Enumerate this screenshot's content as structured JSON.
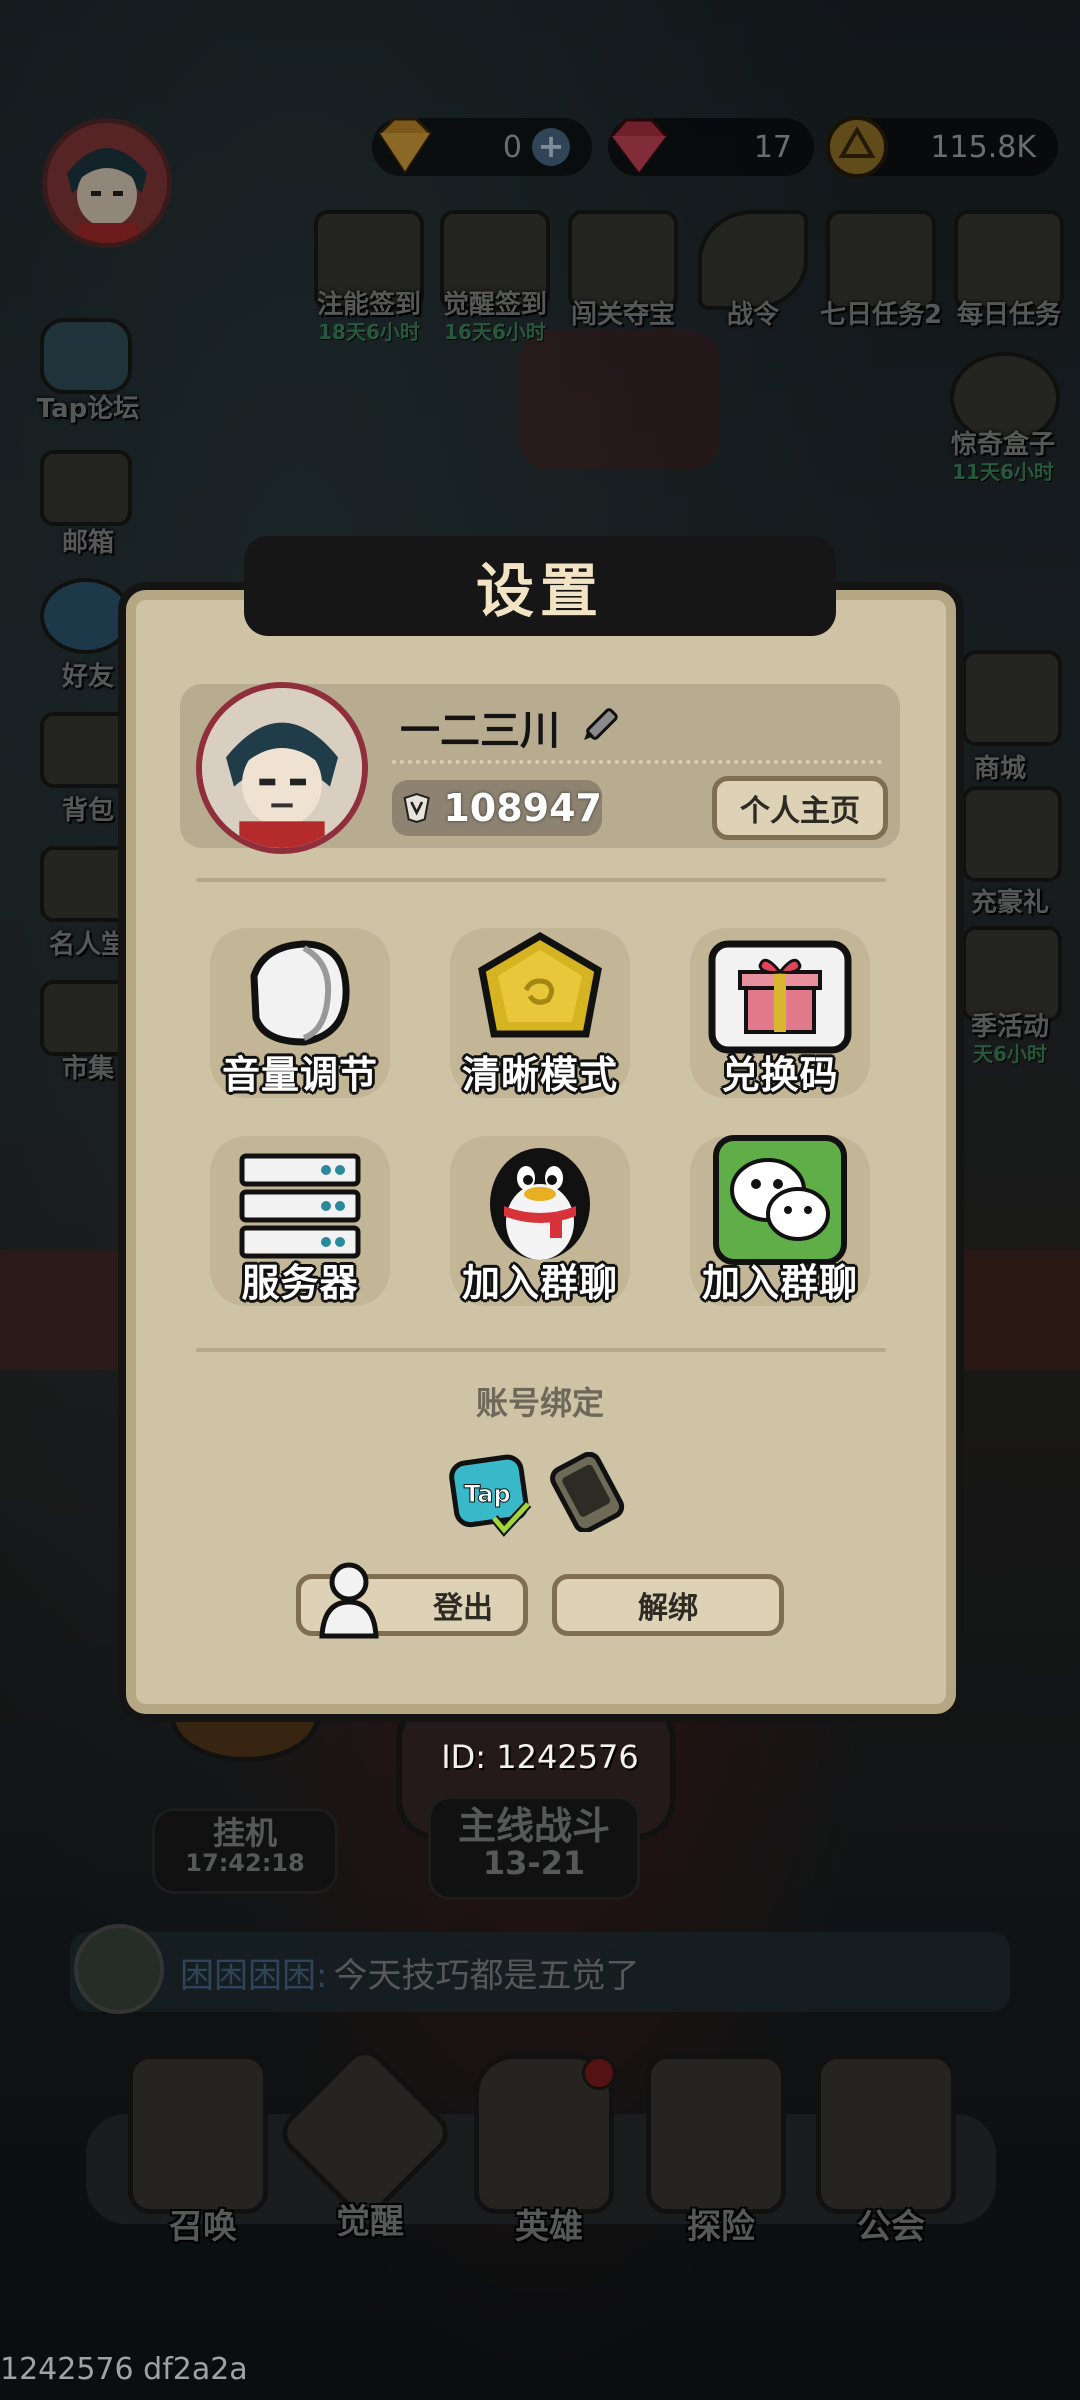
{
  "currency": [
    {
      "name": "diamond-orange",
      "value": "0"
    },
    {
      "name": "gem-red",
      "value": "17"
    },
    {
      "name": "gold-coin",
      "value": "115.8K"
    }
  ],
  "top_events": [
    {
      "label": "注能签到",
      "sub": "18天6小时"
    },
    {
      "label": "觉醒签到",
      "sub": "16天6小时"
    },
    {
      "label": "闯关夺宝",
      "sub": ""
    },
    {
      "label": "战令",
      "sub": ""
    },
    {
      "label": "七日任务2",
      "sub": ""
    },
    {
      "label": "每日任务",
      "sub": ""
    }
  ],
  "right_side": [
    {
      "label": "惊奇盒子",
      "sub": "11天6小时"
    },
    {
      "label": "商城",
      "sub": ""
    },
    {
      "label": "充豪礼",
      "sub": ""
    },
    {
      "label": "季活动",
      "sub": "天6小时"
    }
  ],
  "left_side": [
    {
      "label": "Tap论坛"
    },
    {
      "label": "邮箱"
    },
    {
      "label": "好友"
    },
    {
      "label": "背包"
    },
    {
      "label": "名人堂"
    },
    {
      "label": "市集"
    }
  ],
  "settings": {
    "title": "设置",
    "username": "一二三川",
    "power": "108947",
    "profile_button": "个人主页",
    "grid": [
      {
        "label": "音量调节",
        "icon": "speaker-icon"
      },
      {
        "label": "清晰模式",
        "icon": "gem-icon"
      },
      {
        "label": "兑换码",
        "icon": "gift-icon"
      },
      {
        "label": "服务器",
        "icon": "server-icon"
      },
      {
        "label": "加入群聊",
        "icon": "qq-penguin-icon"
      },
      {
        "label": "加入群聊",
        "icon": "wechat-icon"
      }
    ],
    "bind_title": "账号绑定",
    "logout": "登出",
    "unbind": "解绑"
  },
  "id_text": "ID: 1242576",
  "idle": {
    "label": "挂机",
    "time": "17:42:18"
  },
  "main_battle": {
    "label": "主线战斗",
    "stage": "13-21"
  },
  "chat": {
    "name": "困困困困:",
    "message": "今天技巧都是五觉了"
  },
  "bottom_nav": [
    "召唤",
    "觉醒",
    "英雄",
    "探险",
    "公会"
  ],
  "debug_text": "1242576 df2a2a",
  "colors": {
    "panel": "#cfc3a6",
    "title_bg": "#161616",
    "accent_blue": "#4d6f8c",
    "chat_name": "#5a7fa8"
  }
}
